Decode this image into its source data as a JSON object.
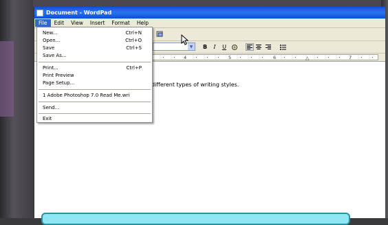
{
  "window": {
    "title": "Document - WordPad"
  },
  "menubar": {
    "items": [
      "File",
      "Edit",
      "View",
      "Insert",
      "Format",
      "Help"
    ]
  },
  "file_menu": {
    "new": {
      "label": "New...",
      "shortcut": "Ctrl+N"
    },
    "open": {
      "label": "Open...",
      "shortcut": "Ctrl+O"
    },
    "save": {
      "label": "Save",
      "shortcut": "Ctrl+S"
    },
    "save_as": {
      "label": "Save As..."
    },
    "print": {
      "label": "Print...",
      "shortcut": "Ctrl+P"
    },
    "print_preview": {
      "label": "Print Preview"
    },
    "page_setup": {
      "label": "Page Setup..."
    },
    "recent": {
      "label": "1 Adobe Photoshop 7.0 Read Me.wri"
    },
    "send": {
      "label": "Send..."
    },
    "exit": {
      "label": "Exit"
    }
  },
  "formatbar": {
    "bold": "B",
    "italic": "I",
    "underline": "U"
  },
  "ruler": {
    "numbers": [
      "4",
      "5",
      "6",
      "7"
    ]
  },
  "document": {
    "text": "different types of writing styles."
  },
  "colors": {
    "titlebar": "#0a53d6",
    "menu_highlight": "#316ac5",
    "panel": "#8fe6f3"
  }
}
